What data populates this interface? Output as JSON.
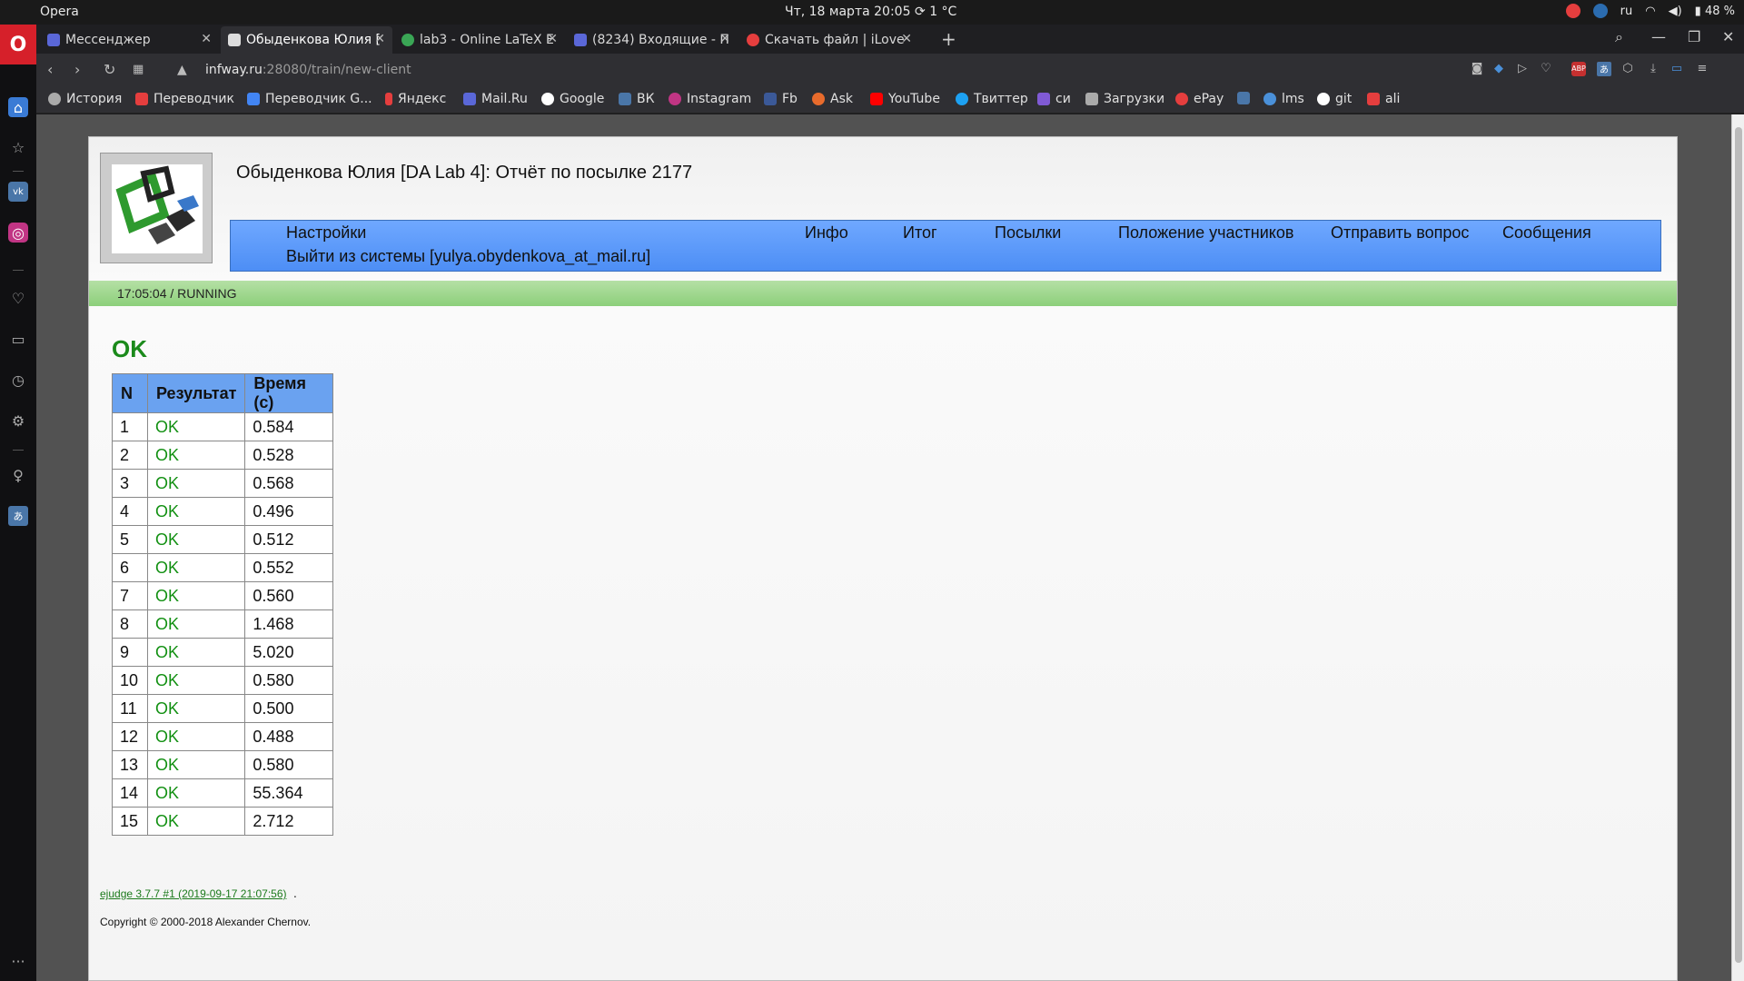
{
  "os": {
    "app_name": "Opera",
    "clock": "Чт, 18 марта  20:05",
    "weather": "1 °C",
    "lang": "ru",
    "battery": "48 %"
  },
  "tabs": [
    {
      "label": "Мессенджер",
      "color": "#5a67d8"
    },
    {
      "label": "Обыденкова Юлия [",
      "color": "#dddddd"
    },
    {
      "label": "lab3 - Online LaTeX E",
      "color": "#3aa655"
    },
    {
      "label": "(8234) Входящие - П",
      "color": "#5a67d8"
    },
    {
      "label": "Скачать файл | iLove",
      "color": "#e53e3e"
    }
  ],
  "address": {
    "host": "infway.ru",
    "path": ":28080/train/new-client"
  },
  "bookmarks": [
    {
      "label": "История",
      "color": "#aaaaaa"
    },
    {
      "label": "Переводчик",
      "color": "#e53e3e"
    },
    {
      "label": "Переводчик G...",
      "color": "#4285f4"
    },
    {
      "label": "Яндекс",
      "color": "#e53e3e"
    },
    {
      "label": "Mail.Ru",
      "color": "#5a67d8"
    },
    {
      "label": "Google",
      "color": "#ffffff"
    },
    {
      "label": "ВК",
      "color": "#4a76a8"
    },
    {
      "label": "Instagram",
      "color": "#c13584"
    },
    {
      "label": "Fb",
      "color": "#3b5998"
    },
    {
      "label": "Ask",
      "color": "#e86b2c"
    },
    {
      "label": "YouTube",
      "color": "#ff0000"
    },
    {
      "label": "Твиттер",
      "color": "#1da1f2"
    },
    {
      "label": "си",
      "color": "#805ad5"
    },
    {
      "label": "Загрузки",
      "color": "#aaaaaa"
    },
    {
      "label": "ePay",
      "color": "#e53e3e"
    },
    {
      "label": "",
      "color": "#4a76a8"
    },
    {
      "label": "lms",
      "color": "#4a90d9"
    },
    {
      "label": "git",
      "color": "#ffffff"
    },
    {
      "label": "ali",
      "color": "#e53e3e"
    }
  ],
  "page": {
    "title": "Обыденкова Юлия [DA Lab 4]: Отчёт по посылке 2177",
    "menu": {
      "settings": "Настройки",
      "logout": "Выйти из системы [yulya.obydenkova_at_mail.ru]",
      "info": "Инфо",
      "summary": "Итог",
      "submissions": "Посылки",
      "standings": "Положение участников",
      "ask": "Отправить вопрос",
      "messages": "Сообщения"
    },
    "status": "17:05:04 / RUNNING",
    "verdict": "OK",
    "table": {
      "headers": [
        "N",
        "Результат",
        "Время (с)"
      ],
      "rows": [
        [
          "1",
          "OK",
          "0.584"
        ],
        [
          "2",
          "OK",
          "0.528"
        ],
        [
          "3",
          "OK",
          "0.568"
        ],
        [
          "4",
          "OK",
          "0.496"
        ],
        [
          "5",
          "OK",
          "0.512"
        ],
        [
          "6",
          "OK",
          "0.552"
        ],
        [
          "7",
          "OK",
          "0.560"
        ],
        [
          "8",
          "OK",
          "1.468"
        ],
        [
          "9",
          "OK",
          "5.020"
        ],
        [
          "10",
          "OK",
          "0.580"
        ],
        [
          "11",
          "OK",
          "0.500"
        ],
        [
          "12",
          "OK",
          "0.488"
        ],
        [
          "13",
          "OK",
          "0.580"
        ],
        [
          "14",
          "OK",
          "55.364"
        ],
        [
          "15",
          "OK",
          "2.712"
        ]
      ]
    },
    "footer_link": "ejudge 3.7.7 #1 (2019-09-17 21:07:56)",
    "footer_dot": ".",
    "copyright": "Copyright © 2000-2018 Alexander Chernov."
  }
}
